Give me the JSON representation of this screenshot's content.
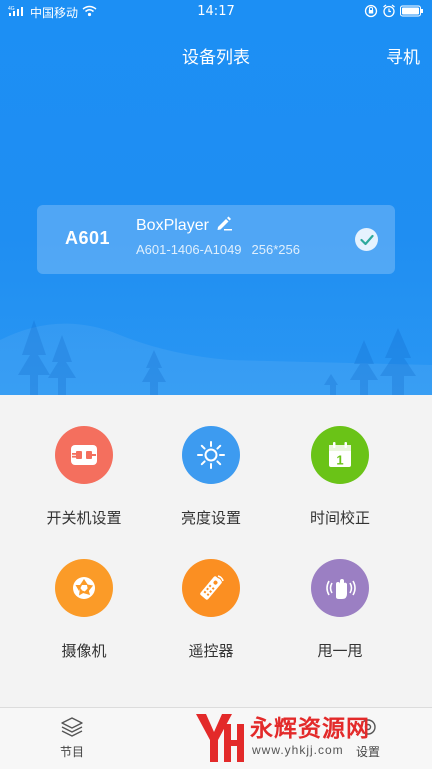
{
  "status_bar": {
    "network_label": "4G",
    "carrier": "中国移动",
    "time": "14:17",
    "icons": [
      "signal-icon",
      "wifi-icon",
      "lock-rotation-icon",
      "alarm-icon",
      "battery-icon"
    ]
  },
  "nav": {
    "title": "设备列表",
    "action": "寻机"
  },
  "device": {
    "id": "A601",
    "name": "BoxPlayer",
    "serial": "A601-1406-A1049",
    "resolution": "256*256",
    "selected": true,
    "edit_icon": "edit-icon",
    "check_icon": "check-icon"
  },
  "menu": {
    "items": [
      {
        "label": "开关机设置",
        "icon": "power-plug-icon",
        "color": "#f46f5e"
      },
      {
        "label": "亮度设置",
        "icon": "sun-icon",
        "color": "#3d9bf0"
      },
      {
        "label": "时间校正",
        "icon": "calendar-icon",
        "color": "#6ac317"
      },
      {
        "label": "摄像机",
        "icon": "camera-aperture-icon",
        "color": "#fb9b28"
      },
      {
        "label": "遥控器",
        "icon": "remote-control-icon",
        "color": "#fb8f22"
      },
      {
        "label": "甩一甩",
        "icon": "shake-icon",
        "color": "#9b7fc3"
      }
    ]
  },
  "tabs": [
    {
      "label": "节目",
      "icon": "layers-icon"
    },
    {
      "label": "设置",
      "icon": "settings-icon"
    }
  ],
  "watermark": {
    "logo_text": "YH",
    "text": "永辉资源网",
    "url": "www.yhkjj.com"
  },
  "colors": {
    "primary_blue": "#1c8ff4",
    "background": "#f3f3f3"
  }
}
